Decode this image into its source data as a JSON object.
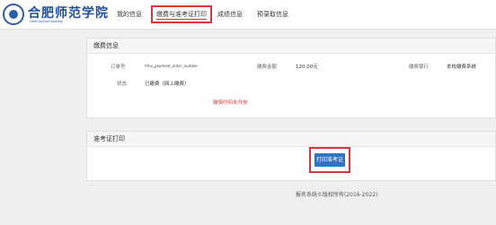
{
  "header": {
    "logo_text": "合肥师范学院",
    "logo_subtext": "Hefei Normal University"
  },
  "nav": {
    "items": [
      {
        "label": "我的信息"
      },
      {
        "label": "缴费与准考证打印",
        "active": true
      },
      {
        "label": "成绩信息"
      },
      {
        "label": "预录取信息"
      }
    ]
  },
  "payment": {
    "title": "缴费信息",
    "order_label": "订单号",
    "order_value": "hfnu_payment_order_number",
    "amount_label": "缴费金额",
    "amount_value": "120.00元",
    "bank_label": "缴费银行",
    "bank_value": "本校缴费系统",
    "status_label": "状态",
    "status_value": "已缴费（网上缴费）",
    "notice": "缴费时间未开放"
  },
  "admission": {
    "title": "准考证打印",
    "print_button": "打印准考证"
  },
  "footer": {
    "copyright": "报名系统©版权所有(2016-2022)"
  },
  "colors": {
    "primary_blue": "#2c74c6",
    "highlight_red": "#d9363e",
    "notice_red": "#e23b3b",
    "background": "#efefef"
  }
}
